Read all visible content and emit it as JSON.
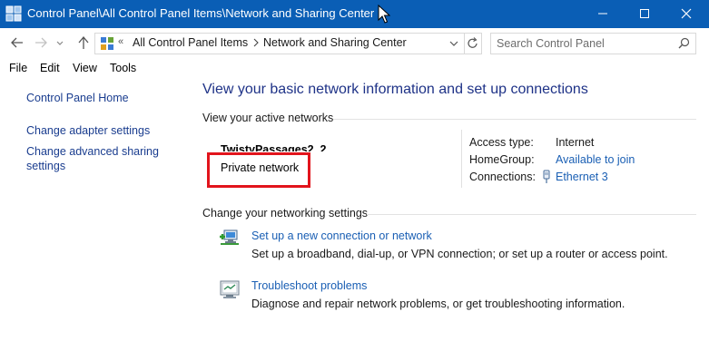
{
  "window": {
    "title": "Control Panel\\All Control Panel Items\\Network and Sharing Center",
    "title_bar_color": "#0a5eb5"
  },
  "address": {
    "overflow": "«",
    "crumbs": [
      "All Control Panel Items",
      "Network and Sharing Center"
    ]
  },
  "search": {
    "placeholder": "Search Control Panel"
  },
  "menu": [
    "File",
    "Edit",
    "View",
    "Tools"
  ],
  "sidebar": {
    "items": [
      {
        "label": "Control Panel Home"
      },
      {
        "label": "Change adapter settings"
      },
      {
        "label": "Change advanced sharing settings"
      }
    ]
  },
  "main": {
    "heading": "View your basic network information and set up connections",
    "active_networks_label": "View your active networks",
    "network": {
      "name": "TwistyPassages2_2",
      "type": "Private network",
      "properties": [
        {
          "label": "Access type:",
          "value": "Internet",
          "is_link": false
        },
        {
          "label": "HomeGroup:",
          "value": "Available to join",
          "is_link": true
        },
        {
          "label": "Connections:",
          "value": "Ethernet 3",
          "is_link": true,
          "icon": "ethernet-icon"
        }
      ]
    },
    "change_settings_label": "Change your networking settings",
    "tasks": [
      {
        "icon": "new-connection-icon",
        "link": "Set up a new connection or network",
        "description": "Set up a broadband, dial-up, or VPN connection; or set up a router or access point."
      },
      {
        "icon": "troubleshoot-icon",
        "link": "Troubleshoot problems",
        "description": "Diagnose and repair network problems, or get troubleshooting information."
      }
    ]
  },
  "colors": {
    "link": "#1a5fb4",
    "heading": "#1e3287",
    "highlight": "#e2141c"
  }
}
